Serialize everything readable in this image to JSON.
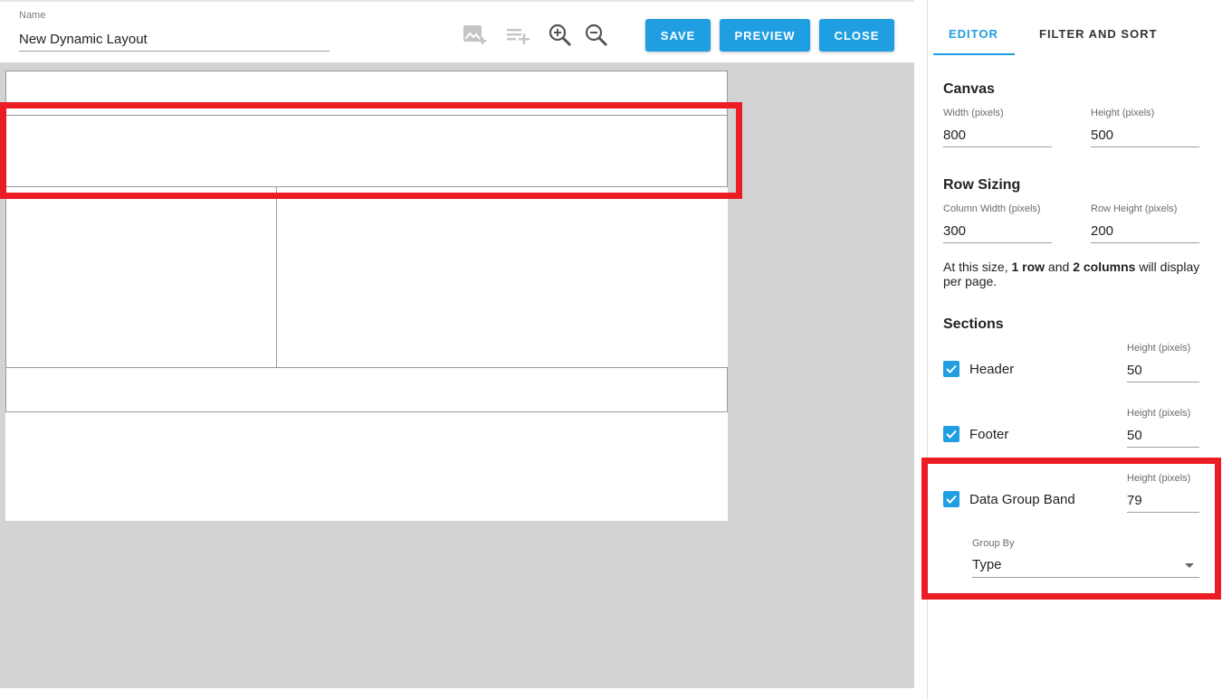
{
  "header": {
    "name_label": "Name",
    "name_value": "New Dynamic Layout",
    "tools": [
      "add-image-icon",
      "add-list-icon",
      "zoom-in-icon",
      "zoom-out-icon"
    ],
    "buttons": {
      "save": "SAVE",
      "preview": "PREVIEW",
      "close": "CLOSE"
    }
  },
  "panel": {
    "tabs": {
      "editor": "EDITOR",
      "filter_sort": "FILTER AND SORT"
    },
    "canvas": {
      "title": "Canvas",
      "width_label": "Width (pixels)",
      "width_value": "800",
      "height_label": "Height (pixels)",
      "height_value": "500"
    },
    "row_sizing": {
      "title": "Row Sizing",
      "column_width_label": "Column Width (pixels)",
      "column_width_value": "300",
      "row_height_label": "Row Height (pixels)",
      "row_height_value": "200",
      "info_prefix": "At this size, ",
      "info_rows": "1 row",
      "info_and": " and ",
      "info_cols": "2 columns",
      "info_suffix": " will display per page."
    },
    "sections": {
      "title": "Sections",
      "header": {
        "label": "Header",
        "checked": true,
        "height_label": "Height (pixels)",
        "height_value": "50"
      },
      "footer": {
        "label": "Footer",
        "checked": true,
        "height_label": "Height (pixels)",
        "height_value": "50"
      },
      "data_group_band": {
        "label": "Data Group Band",
        "checked": true,
        "height_label": "Height (pixels)",
        "height_value": "79"
      },
      "group_by_label": "Group By",
      "group_by_value": "Type"
    }
  },
  "colors": {
    "accent": "#1f9ee1",
    "highlight": "#ec1c24",
    "workspace": "#d3d3d3"
  }
}
